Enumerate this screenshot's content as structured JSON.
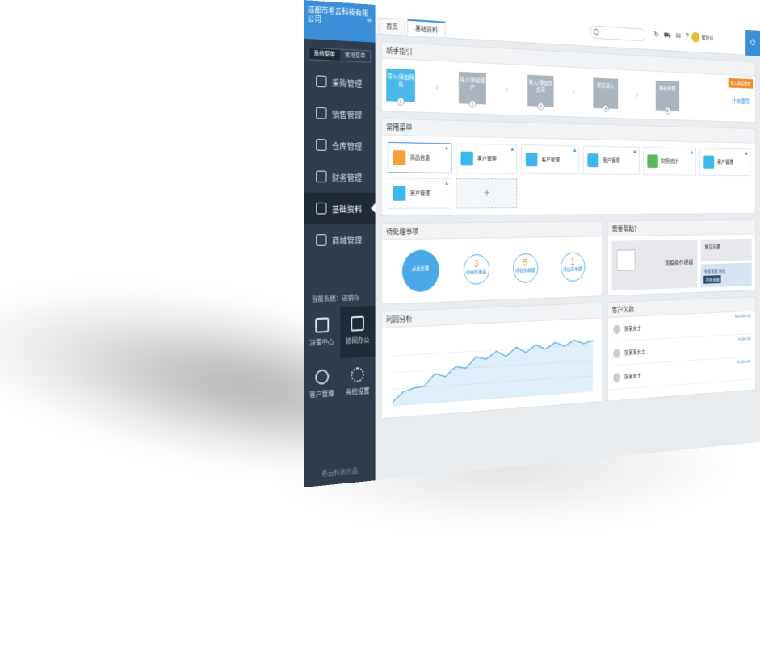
{
  "sidebar": {
    "company": "成都市希云科技有限公司",
    "switch": [
      "系统菜单",
      "常用菜单"
    ],
    "items": [
      {
        "label": "采购管理",
        "icon": "truck-icon"
      },
      {
        "label": "销售管理",
        "icon": "clipboard-icon"
      },
      {
        "label": "仓库管理",
        "icon": "warehouse-icon"
      },
      {
        "label": "财务管理",
        "icon": "money-bag-icon"
      },
      {
        "label": "基础资料",
        "icon": "user-icon"
      },
      {
        "label": "商城管理",
        "icon": "list-icon"
      }
    ],
    "current_system": "当前系统：进销存",
    "apps": [
      {
        "label": "决策中心",
        "icon": "chart-icon"
      },
      {
        "label": "协同办公",
        "icon": "document-icon"
      },
      {
        "label": "客户管理",
        "icon": "person-icon"
      },
      {
        "label": "系统设置",
        "icon": "gear-icon"
      }
    ],
    "brand": "希云科技出品"
  },
  "topbar": {
    "tabs": [
      "首页",
      "基础资料"
    ],
    "search_placeholder": "",
    "user": "管理员",
    "icons": [
      "refresh-icon",
      "cart-icon",
      "mail-icon",
      "help-icon"
    ]
  },
  "guide": {
    "title": "新手指引",
    "badge": "导入商品数据",
    "steps": [
      "导入/添加商品",
      "导入/添加客户",
      "导入/添加供应商",
      "期初录入",
      "期初审核"
    ],
    "start": "开始使用"
  },
  "shortcuts": {
    "title": "常用菜单",
    "items": [
      {
        "label": "商品信息",
        "color": "#f5a13a"
      },
      {
        "label": "客户管理",
        "color": "#3bb7ec"
      },
      {
        "label": "客户管理",
        "color": "#3bb7ec"
      },
      {
        "label": "客户管理",
        "color": "#3bb7ec"
      },
      {
        "label": "财务统计",
        "color": "#5cb85c"
      },
      {
        "label": "客户管理",
        "color": "#3bb7ec"
      },
      {
        "label": "客户管理",
        "color": "#3bb7ec"
      }
    ],
    "add": "+"
  },
  "todo": {
    "title": "待处理事项",
    "main": "点此处理",
    "items": [
      {
        "count": "3",
        "label": "待审核单据"
      },
      {
        "count": "5",
        "label": "待收货单据"
      },
      {
        "count": "1",
        "label": "待出库单据"
      }
    ]
  },
  "help": {
    "title": "需要帮助？",
    "video": "观看操作视频",
    "faq": "常见问题",
    "hotline": "专属客服 热线",
    "online": "在线咨询"
  },
  "profit": {
    "title": "利润分析",
    "tooltip": "",
    "chart_data": {
      "type": "area",
      "x": [
        0,
        1,
        2,
        3,
        4,
        5,
        6,
        7,
        8,
        9,
        10,
        11,
        12,
        13,
        14,
        15,
        16,
        17,
        18,
        19,
        20
      ],
      "values": [
        5,
        18,
        22,
        24,
        40,
        35,
        48,
        45,
        60,
        56,
        66,
        58,
        70,
        62,
        72,
        65,
        74,
        68,
        76,
        70,
        74
      ]
    }
  },
  "clients": {
    "title": "客户欠款",
    "rows": [
      {
        "name": "张某女士",
        "amount": "¥20000.00"
      },
      {
        "name": "张某某女士",
        "amount": "¥100.00"
      },
      {
        "name": "张某女士",
        "amount": "¥2000.00"
      }
    ]
  }
}
